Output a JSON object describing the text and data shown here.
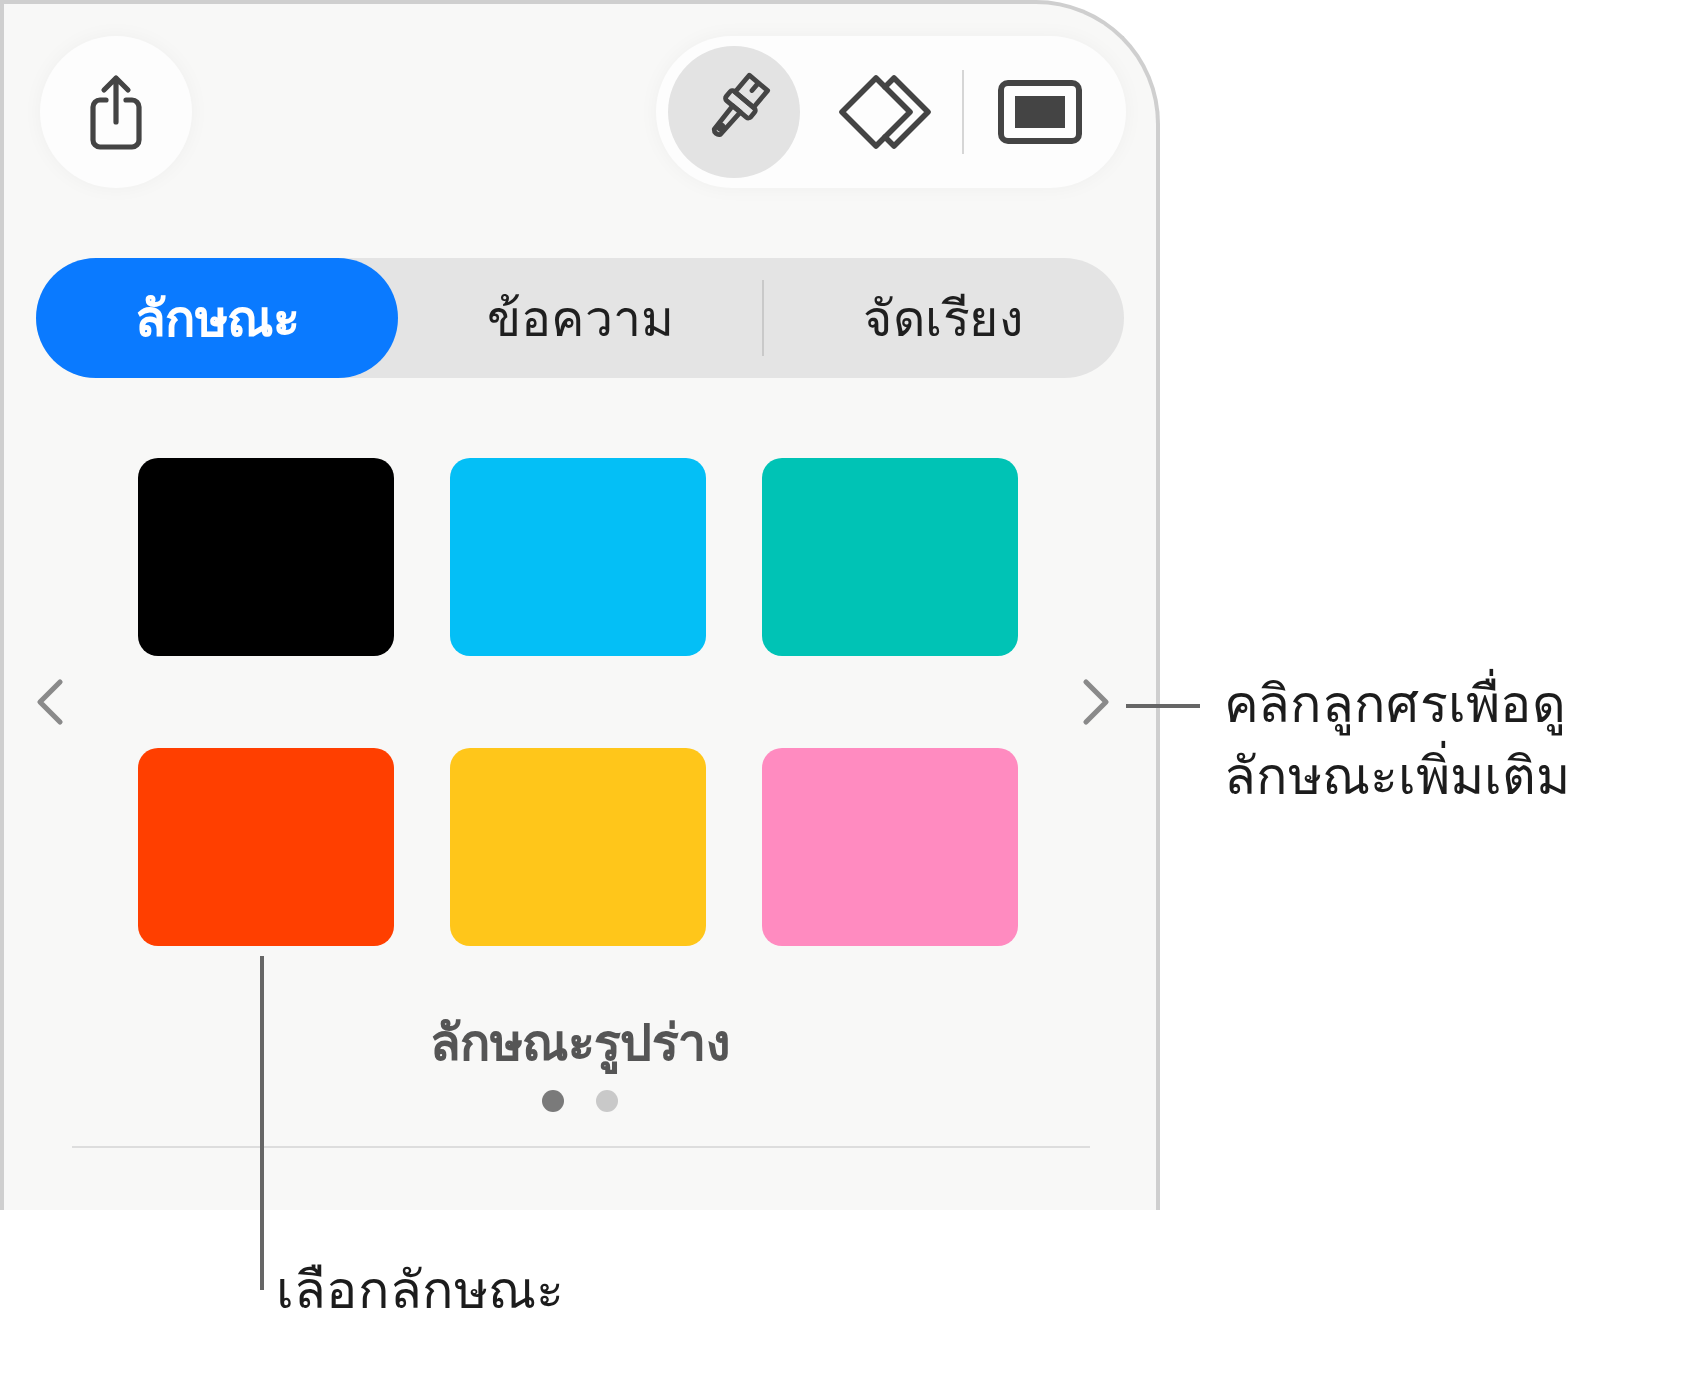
{
  "toolbar": {
    "tools": [
      {
        "kind": "brush",
        "selected": true
      },
      {
        "kind": "arrange",
        "selected": false
      },
      {
        "kind": "document",
        "selected": false
      }
    ]
  },
  "tabs": [
    {
      "label": "ลักษณะ",
      "selected": true
    },
    {
      "label": "ข้อความ",
      "selected": false
    },
    {
      "label": "จัดเรียง",
      "selected": false
    }
  ],
  "styles": {
    "swatches": [
      {
        "color": "#000000"
      },
      {
        "color": "#04bff6"
      },
      {
        "color": "#00c3b5"
      },
      {
        "color": "#ff3f00"
      },
      {
        "color": "#ffc61a"
      },
      {
        "color": "#ff8bc0"
      }
    ],
    "caption": "ลักษณะรูปร่าง",
    "pages": [
      {
        "selected": true
      },
      {
        "selected": false
      }
    ]
  },
  "callouts": [
    {
      "kind": "right",
      "text": "คลิกลูกศรเพื่อดู\nลักษณะเพิ่มเติม"
    },
    {
      "kind": "below",
      "text": "เลือกลักษณะ"
    }
  ]
}
